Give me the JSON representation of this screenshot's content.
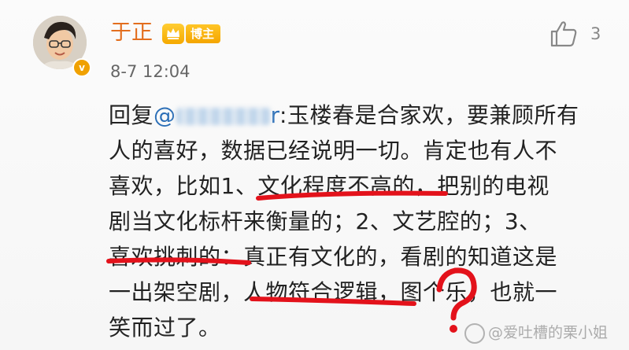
{
  "post": {
    "username": "于正",
    "role_badge": "博主",
    "timestamp": "8-7 12:04",
    "like_count": "3",
    "reply_prefix": "回复",
    "mention_visible": "@",
    "mention_tail": "r",
    "lines": [
      ":玉楼春是合家欢，要兼顾所有",
      "人的喜好，数据已经说明一切。肯定也有人不",
      "喜欢，比如1、文化程度不高的，把别的电视",
      "剧当文化标杆来衡量的；2、文艺腔的；3、",
      "喜欢挑刺的：真正有文化的，看剧的知道这是",
      "一出架空剧，人物符合逻辑，图个乐，也就一",
      "笑而过了。"
    ]
  },
  "annotations": {
    "underline_color": "#e3121b",
    "question_mark": "?"
  },
  "watermark": {
    "text": "@爱吐槽的栗小姐"
  },
  "colors": {
    "username": "#e36e1e",
    "mention": "#2c6fb7",
    "badge": "#f5a900"
  }
}
